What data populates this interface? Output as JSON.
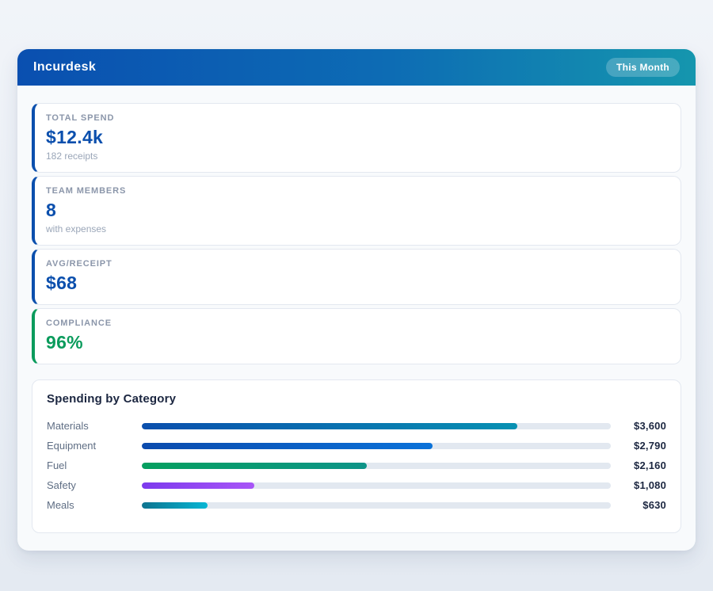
{
  "header": {
    "title": "Incurdesk",
    "period_badge": "This Month"
  },
  "stats": [
    {
      "label": "TOTAL SPEND",
      "value": "$12.4k",
      "sub": "182 receipts",
      "accent": "#0b4fad"
    },
    {
      "label": "TEAM MEMBERS",
      "value": "8",
      "sub": "with expenses",
      "accent": "#0b4fad"
    },
    {
      "label": "AVG/RECEIPT",
      "value": "$68",
      "sub": "",
      "accent": "#0b4fad"
    },
    {
      "label": "COMPLIANCE",
      "value": "96%",
      "sub": "",
      "accent": "#0a9b5c"
    }
  ],
  "chart_data": {
    "type": "bar",
    "orientation": "horizontal",
    "title": "Spending by Category",
    "categories": [
      "Materials",
      "Equipment",
      "Fuel",
      "Safety",
      "Meals"
    ],
    "values": [
      3600,
      2790,
      2160,
      1080,
      630
    ],
    "value_labels": [
      "$3,600",
      "$2,790",
      "$2,160",
      "$1,080",
      "$630"
    ],
    "axis_max": 4500,
    "grid": false,
    "legend": false,
    "track_color": "#e2e8f0",
    "bar_gradients": [
      [
        "#0b4fad",
        "#0891b2"
      ],
      [
        "#0b4bad",
        "#0b72d9"
      ],
      [
        "#059f5f",
        "#0d9488"
      ],
      [
        "#7c3aed",
        "#a855f7"
      ],
      [
        "#0e7490",
        "#06b6d4"
      ]
    ]
  },
  "colors": {
    "header_gradient_start": "#0a4fb0",
    "header_gradient_end": "#1596ae",
    "accent_blue": "#0b4fad",
    "accent_green": "#0a9b5c",
    "panel_bg": "#f8fafc",
    "card_border": "#e3e8f0",
    "label_gray": "#8b96aa",
    "dark_text": "#1b2640"
  }
}
